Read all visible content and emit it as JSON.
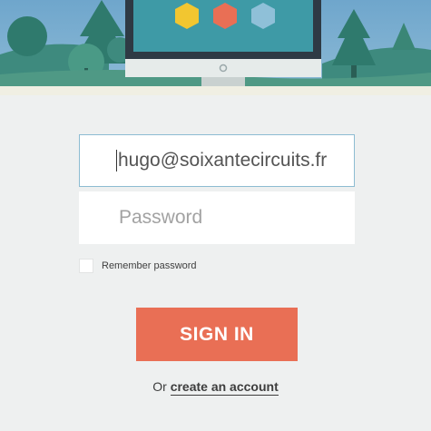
{
  "hero": {
    "scene": "illustration of computer monitor in forest",
    "hexagon_colors": [
      "#f2c630",
      "#e96f55",
      "#8fc0d8"
    ]
  },
  "login": {
    "email_value": "hugo@soixantecircuits.fr",
    "password_placeholder": "Password",
    "remember_label": "Remember password",
    "remember_checked": false,
    "signin_label": "SIGN IN",
    "or_text": "Or",
    "create_account_label": "create an account"
  },
  "colors": {
    "accent": "#e96f55",
    "background": "#eef0f0",
    "input_focus_border": "#8dbcd2"
  }
}
